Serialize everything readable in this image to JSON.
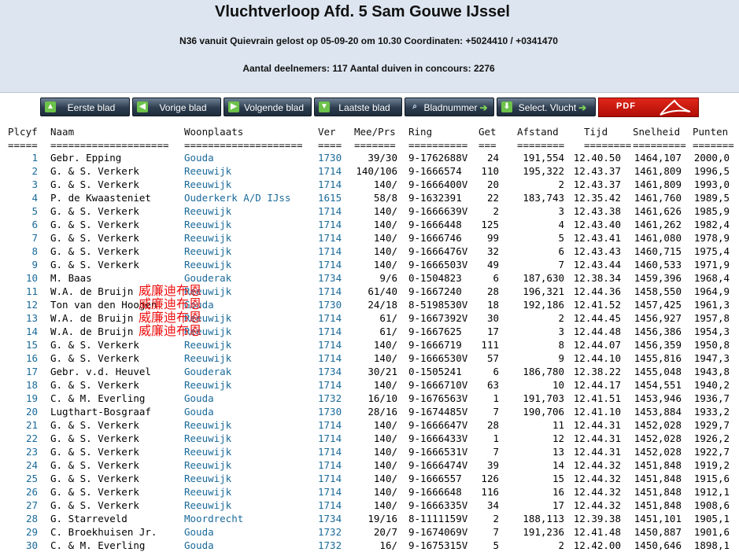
{
  "header": {
    "title": "Vluchtverloop Afd. 5 Sam Gouwe IJssel",
    "subtitle": "N36 vanuit Quievrain gelost op 05-09-20 om 10.30 Coordinaten: +5024410 / +0341470",
    "participants": "Aantal deelnemers: 117 Aantal duiven in concours: 2276"
  },
  "toolbar": {
    "buttons": [
      {
        "label": "Eerste blad",
        "icon": "arrow-up-icon"
      },
      {
        "label": "Vorige blad",
        "icon": "arrow-left-icon"
      },
      {
        "label": "Volgende blad",
        "icon": "arrow-right-icon"
      },
      {
        "label": "Laatste blad",
        "icon": "arrow-down-icon"
      },
      {
        "label": "Bladnummer",
        "icon": "magnifier-icon"
      },
      {
        "label": "Select. Vlucht",
        "icon": "download-icon"
      }
    ],
    "pdf_label": "PDF"
  },
  "table": {
    "columns": [
      "Plcyf",
      "Naam",
      "Woonplaats",
      "Ver",
      "Mee/Prs",
      "Ring",
      "Get",
      "Afstand",
      "Tijd",
      "Snelheid",
      "Punten"
    ],
    "separators": [
      "=====",
      "====================",
      "====================",
      "====",
      "=======",
      "==========",
      "===",
      "========",
      "========",
      "=========",
      "======="
    ],
    "rows": [
      [
        "1",
        "Gebr. Epping",
        "Gouda",
        "1730",
        "39/30",
        "9-1762688V",
        "24",
        "191,554",
        "12.40.50",
        "1464,107",
        "2000,0"
      ],
      [
        "2",
        "G. & S. Verkerk",
        "Reeuwijk",
        "1714",
        "140/106",
        "9-1666574",
        "110",
        "195,322",
        "12.43.37",
        "1461,809",
        "1996,5"
      ],
      [
        "3",
        "G. & S. Verkerk",
        "Reeuwijk",
        "1714",
        "140/",
        "9-1666400V",
        "20",
        "2",
        "12.43.37",
        "1461,809",
        "1993,0"
      ],
      [
        "4",
        "P. de Kwaasteniet",
        "Ouderkerk A/D IJss",
        "1615",
        "58/8",
        "9-1632391",
        "22",
        "183,743",
        "12.35.42",
        "1461,760",
        "1989,5"
      ],
      [
        "5",
        "G. & S. Verkerk",
        "Reeuwijk",
        "1714",
        "140/",
        "9-1666639V",
        "2",
        "3",
        "12.43.38",
        "1461,626",
        "1985,9"
      ],
      [
        "6",
        "G. & S. Verkerk",
        "Reeuwijk",
        "1714",
        "140/",
        "9-1666448",
        "125",
        "4",
        "12.43.40",
        "1461,262",
        "1982,4"
      ],
      [
        "7",
        "G. & S. Verkerk",
        "Reeuwijk",
        "1714",
        "140/",
        "9-1666746",
        "99",
        "5",
        "12.43.41",
        "1461,080",
        "1978,9"
      ],
      [
        "8",
        "G. & S. Verkerk",
        "Reeuwijk",
        "1714",
        "140/",
        "9-1666476V",
        "32",
        "6",
        "12.43.43",
        "1460,715",
        "1975,4"
      ],
      [
        "9",
        "G. & S. Verkerk",
        "Reeuwijk",
        "1714",
        "140/",
        "9-1666503V",
        "49",
        "7",
        "12.43.44",
        "1460,533",
        "1971,9"
      ],
      [
        "10",
        "M. Baas",
        "Gouderak",
        "1734",
        "9/6",
        "0-1504823",
        "6",
        "187,630",
        "12.38.34",
        "1459,396",
        "1968,4"
      ],
      [
        "11",
        "W.A. de Bruijn",
        "Reeuwijk",
        "1714",
        "61/40",
        "9-1667240",
        "28",
        "196,321",
        "12.44.36",
        "1458,550",
        "1964,9"
      ],
      [
        "12",
        "Ton van den Hoogen",
        "Gouda",
        "1730",
        "24/18",
        "8-5198530V",
        "18",
        "192,186",
        "12.41.52",
        "1457,425",
        "1961,3"
      ],
      [
        "13",
        "W.A. de Bruijn",
        "Reeuwijk",
        "1714",
        "61/",
        "9-1667392V",
        "30",
        "2",
        "12.44.45",
        "1456,927",
        "1957,8"
      ],
      [
        "14",
        "W.A. de Bruijn",
        "Reeuwijk",
        "1714",
        "61/",
        "9-1667625",
        "17",
        "3",
        "12.44.48",
        "1456,386",
        "1954,3"
      ],
      [
        "15",
        "G. & S. Verkerk",
        "Reeuwijk",
        "1714",
        "140/",
        "9-1666719",
        "111",
        "8",
        "12.44.07",
        "1456,359",
        "1950,8"
      ],
      [
        "16",
        "G. & S. Verkerk",
        "Reeuwijk",
        "1714",
        "140/",
        "9-1666530V",
        "57",
        "9",
        "12.44.10",
        "1455,816",
        "1947,3"
      ],
      [
        "17",
        "Gebr. v.d. Heuvel",
        "Gouderak",
        "1734",
        "30/21",
        "0-1505241",
        "6",
        "186,780",
        "12.38.22",
        "1455,048",
        "1943,8"
      ],
      [
        "18",
        "G. & S. Verkerk",
        "Reeuwijk",
        "1714",
        "140/",
        "9-1666710V",
        "63",
        "10",
        "12.44.17",
        "1454,551",
        "1940,2"
      ],
      [
        "19",
        "C. & M. Everling",
        "Gouda",
        "1732",
        "16/10",
        "9-1676563V",
        "1",
        "191,703",
        "12.41.51",
        "1453,946",
        "1936,7"
      ],
      [
        "20",
        "Lugthart-Bosgraaf",
        "Gouda",
        "1730",
        "28/16",
        "9-1674485V",
        "7",
        "190,706",
        "12.41.10",
        "1453,884",
        "1933,2"
      ],
      [
        "21",
        "G. & S. Verkerk",
        "Reeuwijk",
        "1714",
        "140/",
        "9-1666647V",
        "28",
        "11",
        "12.44.31",
        "1452,028",
        "1929,7"
      ],
      [
        "22",
        "G. & S. Verkerk",
        "Reeuwijk",
        "1714",
        "140/",
        "9-1666433V",
        "1",
        "12",
        "12.44.31",
        "1452,028",
        "1926,2"
      ],
      [
        "23",
        "G. & S. Verkerk",
        "Reeuwijk",
        "1714",
        "140/",
        "9-1666531V",
        "7",
        "13",
        "12.44.31",
        "1452,028",
        "1922,7"
      ],
      [
        "24",
        "G. & S. Verkerk",
        "Reeuwijk",
        "1714",
        "140/",
        "9-1666474V",
        "39",
        "14",
        "12.44.32",
        "1451,848",
        "1919,2"
      ],
      [
        "25",
        "G. & S. Verkerk",
        "Reeuwijk",
        "1714",
        "140/",
        "9-1666557",
        "126",
        "15",
        "12.44.32",
        "1451,848",
        "1915,6"
      ],
      [
        "26",
        "G. & S. Verkerk",
        "Reeuwijk",
        "1714",
        "140/",
        "9-1666648",
        "116",
        "16",
        "12.44.32",
        "1451,848",
        "1912,1"
      ],
      [
        "27",
        "G. & S. Verkerk",
        "Reeuwijk",
        "1714",
        "140/",
        "9-1666335V",
        "34",
        "17",
        "12.44.32",
        "1451,848",
        "1908,6"
      ],
      [
        "28",
        "G. Starreveld",
        "Moordrecht",
        "1734",
        "19/16",
        "8-1111159V",
        "2",
        "188,113",
        "12.39.38",
        "1451,101",
        "1905,1"
      ],
      [
        "29",
        "C. Broekhuisen Jr.",
        "Gouda",
        "1732",
        "20/7",
        "9-1674069V",
        "7",
        "191,236",
        "12.41.48",
        "1450,887",
        "1901,6"
      ],
      [
        "30",
        "C. & M. Everling",
        "Gouda",
        "1732",
        "16/",
        "9-1675315V",
        "5",
        "2",
        "12.42.00",
        "1450,646",
        "1898,1"
      ]
    ]
  },
  "overlay": {
    "text": "威廉迪布恩",
    "color": "#ee1111"
  }
}
